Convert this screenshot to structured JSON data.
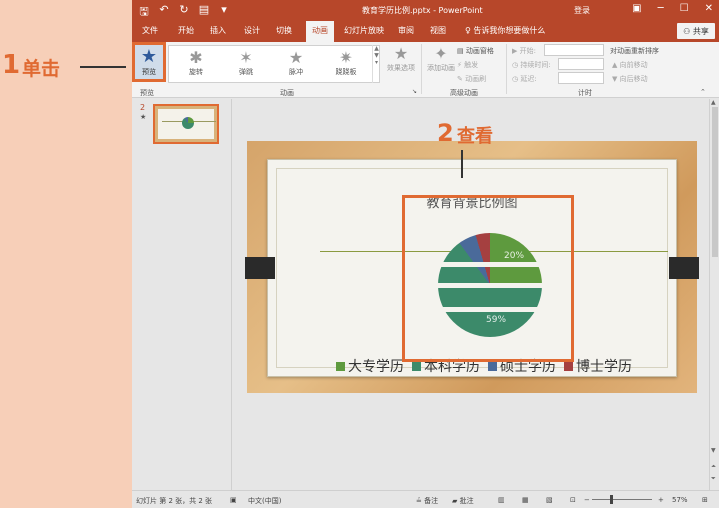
{
  "callouts": {
    "step1_num": "1",
    "step1_text": "单击",
    "step2_num": "2",
    "step2_text": "查看"
  },
  "titlebar": {
    "title": "教育学历比例.pptx - PowerPoint",
    "login": "登录",
    "qat": [
      "save-icon",
      "undo-icon",
      "redo-icon",
      "slideshow-icon"
    ],
    "window_buttons": [
      "ribbon-options-icon",
      "minimize-icon",
      "maximize-icon",
      "close-icon"
    ]
  },
  "tabs": {
    "items": [
      "文件",
      "开始",
      "插入",
      "设计",
      "切换",
      "动画",
      "幻灯片放映",
      "审阅",
      "视图"
    ],
    "active": "动画",
    "tell_me": "告诉我你想要做什么",
    "share": "共享"
  },
  "ribbon": {
    "preview_label": "预览",
    "preview_group": "预览",
    "animation_group": "动画",
    "animations": [
      "旋转",
      "弹跳",
      "脉冲",
      "跷跷板"
    ],
    "effect_options": "效果选项",
    "advanced_group": "高级动画",
    "add_animation": "添加动画",
    "animation_pane": "动画窗格",
    "trigger": "触发",
    "animation_painter": "动画刷",
    "timing_group": "计时",
    "start": "开始:",
    "duration": "持续时间:",
    "delay": "延迟:",
    "reorder": "对动画重新排序",
    "move_earlier": "向前移动",
    "move_later": "向后移动"
  },
  "thumbnails": {
    "slide_number": "2",
    "animation_marker": "★"
  },
  "slide": {
    "title": "教育背景比例图",
    "legend": [
      {
        "name": "大专学历",
        "color": "#5e9a3e"
      },
      {
        "name": "本科学历",
        "color": "#3c8a6a"
      },
      {
        "name": "硕士学历",
        "color": "#4a6a9a"
      },
      {
        "name": "博士学历",
        "color": "#a54040"
      }
    ],
    "pie_labels": [
      "20%",
      "59%"
    ]
  },
  "statusbar": {
    "slide_info": "幻灯片 第 2 张，共 2 张",
    "language": "中文(中国)",
    "notes": "备注",
    "comments": "批注",
    "zoom": "57%"
  }
}
